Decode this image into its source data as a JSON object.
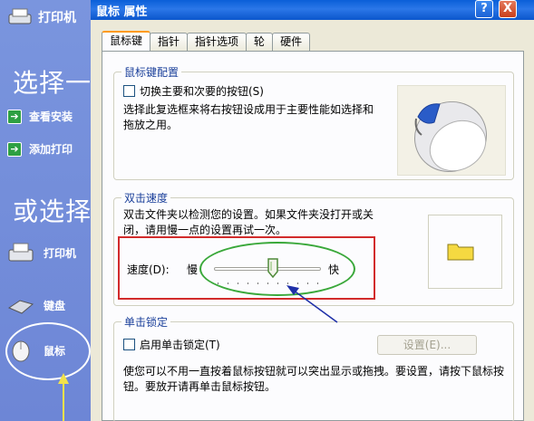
{
  "left_panel": {
    "printer_title": "打印机",
    "heading_choose": "选择一",
    "task_view": "查看安装",
    "task_add": "添加打印",
    "heading_or": "或选择",
    "cat_printer": "打印机",
    "cat_keyboard": "键盘",
    "cat_mouse": "鼠标"
  },
  "dialog": {
    "title": "鼠标 属性",
    "help_glyph": "?",
    "close_glyph": "X",
    "tabs": [
      "鼠标键",
      "指针",
      "指针选项",
      "轮",
      "硬件"
    ],
    "button_config": {
      "label": "鼠标键配置",
      "switch_checkbox": "切换主要和次要的按钮(S)",
      "switch_desc": "选择此复选框来将右按钮设成用于主要性能如选择和拖放之用。"
    },
    "double_click": {
      "label": "双击速度",
      "desc": "双击文件夹以检测您的设置。如果文件夹没打开或关闭，请用慢一点的设置再试一次。",
      "speed_label": "速度(D):",
      "slow": "慢",
      "fast": "快",
      "speed_value": 0.55
    },
    "click_lock": {
      "label": "单击锁定",
      "checkbox": "启用单击锁定(T)",
      "settings_button": "设置(E)...",
      "desc": "使您可以不用一直按着鼠标按钮就可以突出显示或拖拽。要设置，请按下鼠标按钮。要放开请再单击鼠标按钮。"
    }
  },
  "colors": {
    "titlebar": "#0a5fd8",
    "annotation_red": "#d22b2b",
    "annotation_green": "#3aa83a",
    "annotation_blue": "#1e2fa8"
  }
}
